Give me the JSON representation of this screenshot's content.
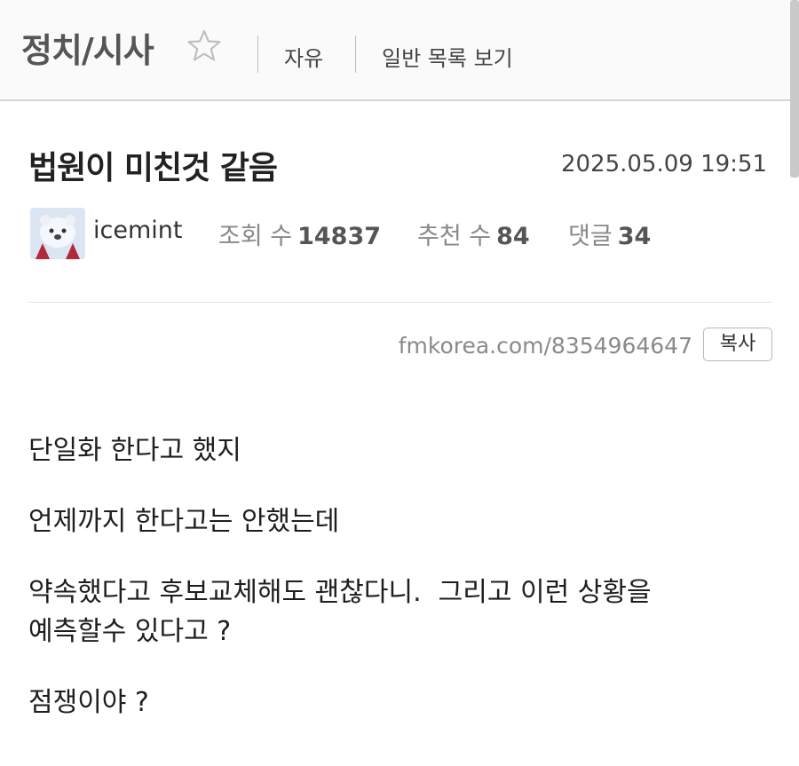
{
  "header": {
    "board_title": "정치/시사",
    "nav_links": [
      "자유",
      "일반 목록 보기"
    ]
  },
  "post": {
    "title": "법원이 미친것 같음",
    "date": "2025.05.09 19:51",
    "author": "icemint",
    "stats": [
      {
        "label": "조회 수",
        "value": "14837"
      },
      {
        "label": "추천 수",
        "value": "84"
      },
      {
        "label": "댓글",
        "value": "34"
      }
    ],
    "url": "fmkorea.com/8354964647",
    "copy_label": "복사",
    "paragraphs": [
      "단일화 한다고 했지",
      "언제까지 한다고는 안했는데",
      "약속했다고 후보교체해도 괜찮다니.  그리고 이런 상황을\n예측할수 있다고 ?",
      "점쟁이야 ?"
    ]
  },
  "icons": {
    "favorite": "star-outline-icon",
    "avatar": "polar-bear-avatar"
  },
  "colors": {
    "header_bg": "#fafafa",
    "text_main": "#222222",
    "text_muted": "#888888"
  }
}
